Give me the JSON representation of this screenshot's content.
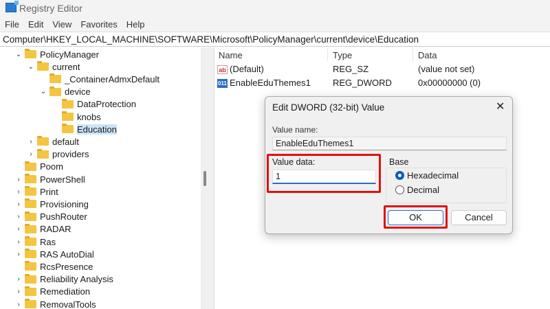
{
  "window": {
    "title": "Registry Editor"
  },
  "menu": [
    "File",
    "Edit",
    "View",
    "Favorites",
    "Help"
  ],
  "address": "Computer\\HKEY_LOCAL_MACHINE\\SOFTWARE\\Microsoft\\PolicyManager\\current\\device\\Education",
  "tree": [
    {
      "label": "PolicyManager",
      "level": 0,
      "state": "expanded"
    },
    {
      "label": "current",
      "level": 1,
      "state": "expanded"
    },
    {
      "label": "_ContainerAdmxDefault",
      "level": 2,
      "state": "leaf"
    },
    {
      "label": "device",
      "level": 2,
      "state": "expanded"
    },
    {
      "label": "DataProtection",
      "level": 3,
      "state": "leaf"
    },
    {
      "label": "knobs",
      "level": 3,
      "state": "leaf"
    },
    {
      "label": "Education",
      "level": 3,
      "state": "leaf",
      "selected": true
    },
    {
      "label": "default",
      "level": 1,
      "state": "collapsed"
    },
    {
      "label": "providers",
      "level": 1,
      "state": "collapsed"
    },
    {
      "label": "Poom",
      "level": 0,
      "state": "leaf"
    },
    {
      "label": "PowerShell",
      "level": 0,
      "state": "collapsed"
    },
    {
      "label": "Print",
      "level": 0,
      "state": "collapsed"
    },
    {
      "label": "Provisioning",
      "level": 0,
      "state": "collapsed"
    },
    {
      "label": "PushRouter",
      "level": 0,
      "state": "collapsed"
    },
    {
      "label": "RADAR",
      "level": 0,
      "state": "collapsed"
    },
    {
      "label": "Ras",
      "level": 0,
      "state": "collapsed"
    },
    {
      "label": "RAS AutoDial",
      "level": 0,
      "state": "collapsed"
    },
    {
      "label": "RcsPresence",
      "level": 0,
      "state": "leaf"
    },
    {
      "label": "Reliability Analysis",
      "level": 0,
      "state": "collapsed"
    },
    {
      "label": "Remediation",
      "level": 0,
      "state": "collapsed"
    },
    {
      "label": "RemovalTools",
      "level": 0,
      "state": "collapsed"
    }
  ],
  "list": {
    "headers": {
      "name": "Name",
      "type": "Type",
      "data": "Data"
    },
    "rows": [
      {
        "icon": "string-value-icon",
        "glyph": "ab",
        "name": "(Default)",
        "type": "REG_SZ",
        "data": "(value not set)"
      },
      {
        "icon": "binary-value-icon",
        "glyph": "011",
        "name": "EnableEduThemes1",
        "type": "REG_DWORD",
        "data": "0x00000000 (0)"
      }
    ]
  },
  "dialog": {
    "title": "Edit DWORD (32-bit) Value",
    "value_name_label": "Value name:",
    "value_name": "EnableEduThemes1",
    "value_data_label": "Value data:",
    "value_data": "1",
    "base_label": "Base",
    "base_options": [
      "Hexadecimal",
      "Decimal"
    ],
    "ok": "OK",
    "cancel": "Cancel"
  },
  "colors": {
    "highlight": "#e01010",
    "selection": "#cce4f7",
    "accent": "#0a5fb4"
  }
}
